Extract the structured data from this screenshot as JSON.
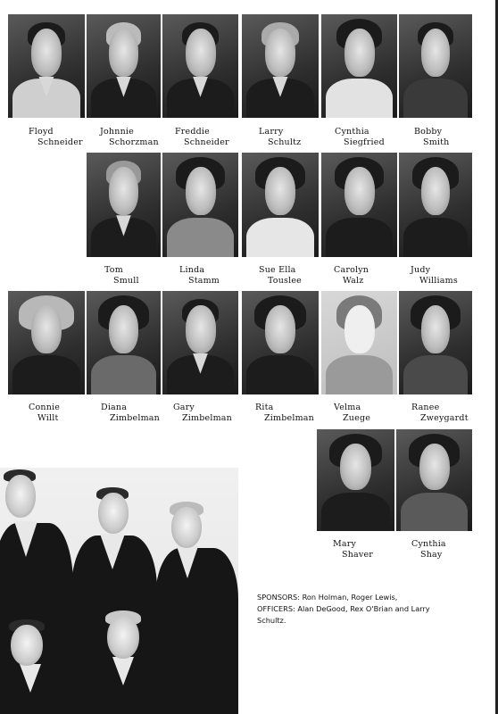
{
  "rows": [
    [
      {
        "first": "Floyd",
        "last": "Schneider"
      },
      {
        "first": "Johnnie",
        "last": "Schorzman"
      },
      {
        "first": "Freddie",
        "last": "Schneider"
      },
      {
        "first": "Larry",
        "last": "Schultz"
      },
      {
        "first": "Cynthia",
        "last": "Siegfried"
      },
      {
        "first": "Bobby",
        "last": "Smith"
      }
    ],
    [
      {
        "first": "Tom",
        "last": "Smull"
      },
      {
        "first": "Linda",
        "last": "Stamm"
      },
      {
        "first": "Sue Ella",
        "last": "Touslee"
      },
      {
        "first": "Carolyn",
        "last": "Walz"
      },
      {
        "first": "Judy",
        "last": "Williams"
      }
    ],
    [
      {
        "first": "Connie",
        "last": "Willt"
      },
      {
        "first": "Diana",
        "last": "Zimbelman"
      },
      {
        "first": "Gary",
        "last": "Zimbelman"
      },
      {
        "first": "Rita",
        "last": "Zimbelman"
      },
      {
        "first": "Velma",
        "last": "Zuege"
      },
      {
        "first": "Ranee",
        "last": "Zweygardt"
      }
    ],
    [
      {
        "first": "Mary",
        "last": "Shaver"
      },
      {
        "first": "Cynthia",
        "last": "Shay"
      }
    ]
  ],
  "caption": {
    "line1": "SPONSORS: Ron Holman, Roger Lewis,",
    "line2": "OFFICERS: Alan DeGood, Rex O'Brian and Larry",
    "line3": "Schultz."
  }
}
